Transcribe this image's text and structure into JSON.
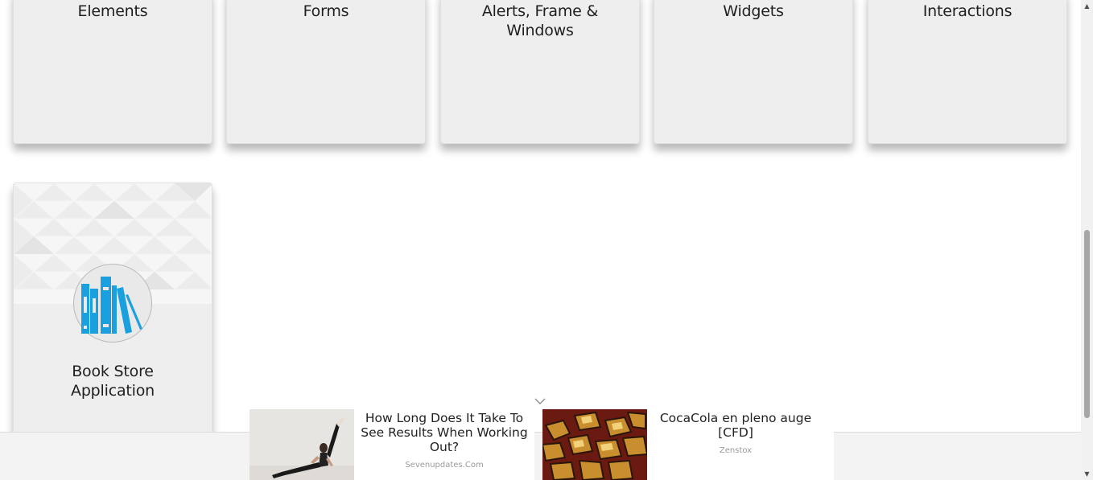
{
  "cards": {
    "elements": "Elements",
    "forms": "Forms",
    "alerts": "Alerts, Frame & Windows",
    "widgets": "Widgets",
    "interactions": "Interactions",
    "book_store": "Book Store Application"
  },
  "book_icon": "books-icon",
  "ads": [
    {
      "title": "How Long Does It Take To See Results When Working Out?",
      "source": "Sevenupdates.Com"
    },
    {
      "title": "CocaCola en pleno auge [CFD]",
      "source": "Zenstox"
    }
  ],
  "colors": {
    "card_bg": "#eeeeee",
    "accent_blue": "#1aa0de"
  }
}
